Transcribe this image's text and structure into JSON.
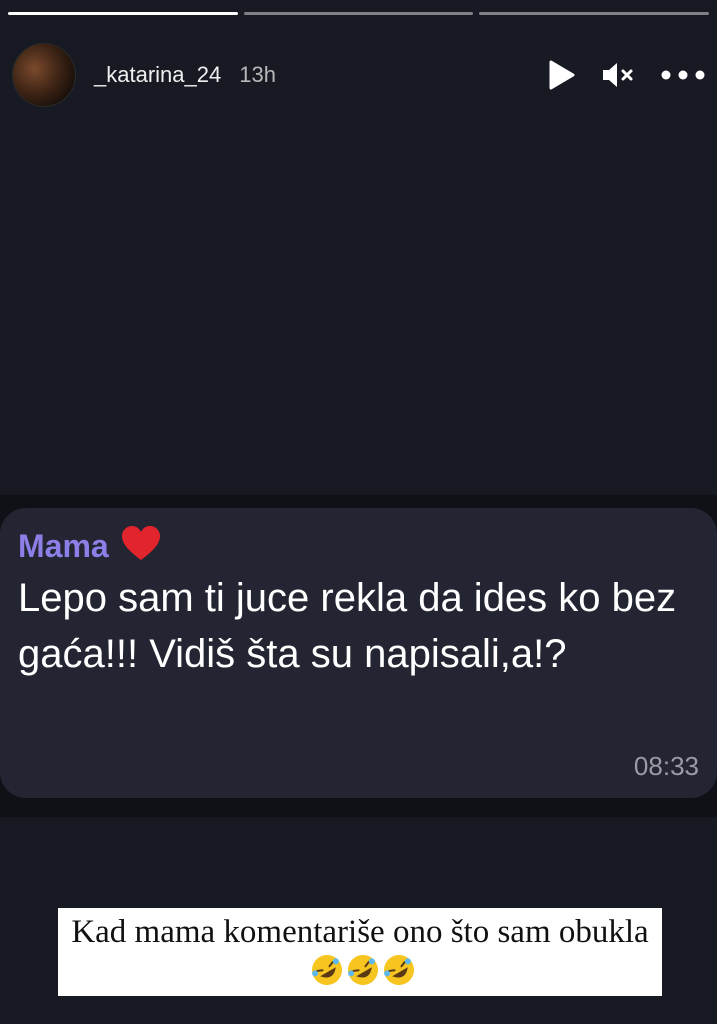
{
  "story": {
    "segments": [
      {
        "state": "active"
      },
      {
        "state": "pending"
      },
      {
        "state": "pending"
      }
    ],
    "username": "_katarina_24",
    "time_ago": "13h"
  },
  "message": {
    "sender": "Mama",
    "sender_color": "#8c7fe8",
    "text": "Lepo sam ti juce rekla da ides ko bez gaća!!! Vidiš šta su napisali,a!?",
    "timestamp": "08:33"
  },
  "caption": {
    "text": "Kad mama komentariše ono što sam obukla",
    "emoji_count": 3
  },
  "icons": {
    "play": "play-icon",
    "mute": "muted-speaker-icon",
    "more": "more-options-icon",
    "heart": "red-heart-emoji",
    "laugh": "rolling-laughing-emoji"
  }
}
